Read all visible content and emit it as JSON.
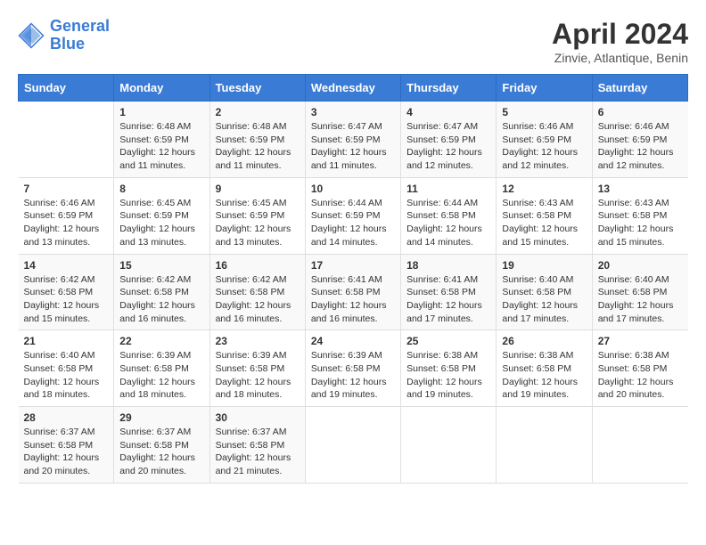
{
  "logo": {
    "line1": "General",
    "line2": "Blue"
  },
  "title": "April 2024",
  "subtitle": "Zinvie, Atlantique, Benin",
  "days_header": [
    "Sunday",
    "Monday",
    "Tuesday",
    "Wednesday",
    "Thursday",
    "Friday",
    "Saturday"
  ],
  "weeks": [
    [
      {
        "day": "",
        "sunrise": "",
        "sunset": "",
        "daylight": ""
      },
      {
        "day": "1",
        "sunrise": "Sunrise: 6:48 AM",
        "sunset": "Sunset: 6:59 PM",
        "daylight": "Daylight: 12 hours and 11 minutes."
      },
      {
        "day": "2",
        "sunrise": "Sunrise: 6:48 AM",
        "sunset": "Sunset: 6:59 PM",
        "daylight": "Daylight: 12 hours and 11 minutes."
      },
      {
        "day": "3",
        "sunrise": "Sunrise: 6:47 AM",
        "sunset": "Sunset: 6:59 PM",
        "daylight": "Daylight: 12 hours and 11 minutes."
      },
      {
        "day": "4",
        "sunrise": "Sunrise: 6:47 AM",
        "sunset": "Sunset: 6:59 PM",
        "daylight": "Daylight: 12 hours and 12 minutes."
      },
      {
        "day": "5",
        "sunrise": "Sunrise: 6:46 AM",
        "sunset": "Sunset: 6:59 PM",
        "daylight": "Daylight: 12 hours and 12 minutes."
      },
      {
        "day": "6",
        "sunrise": "Sunrise: 6:46 AM",
        "sunset": "Sunset: 6:59 PM",
        "daylight": "Daylight: 12 hours and 12 minutes."
      }
    ],
    [
      {
        "day": "7",
        "sunrise": "Sunrise: 6:46 AM",
        "sunset": "Sunset: 6:59 PM",
        "daylight": "Daylight: 12 hours and 13 minutes."
      },
      {
        "day": "8",
        "sunrise": "Sunrise: 6:45 AM",
        "sunset": "Sunset: 6:59 PM",
        "daylight": "Daylight: 12 hours and 13 minutes."
      },
      {
        "day": "9",
        "sunrise": "Sunrise: 6:45 AM",
        "sunset": "Sunset: 6:59 PM",
        "daylight": "Daylight: 12 hours and 13 minutes."
      },
      {
        "day": "10",
        "sunrise": "Sunrise: 6:44 AM",
        "sunset": "Sunset: 6:59 PM",
        "daylight": "Daylight: 12 hours and 14 minutes."
      },
      {
        "day": "11",
        "sunrise": "Sunrise: 6:44 AM",
        "sunset": "Sunset: 6:58 PM",
        "daylight": "Daylight: 12 hours and 14 minutes."
      },
      {
        "day": "12",
        "sunrise": "Sunrise: 6:43 AM",
        "sunset": "Sunset: 6:58 PM",
        "daylight": "Daylight: 12 hours and 15 minutes."
      },
      {
        "day": "13",
        "sunrise": "Sunrise: 6:43 AM",
        "sunset": "Sunset: 6:58 PM",
        "daylight": "Daylight: 12 hours and 15 minutes."
      }
    ],
    [
      {
        "day": "14",
        "sunrise": "Sunrise: 6:42 AM",
        "sunset": "Sunset: 6:58 PM",
        "daylight": "Daylight: 12 hours and 15 minutes."
      },
      {
        "day": "15",
        "sunrise": "Sunrise: 6:42 AM",
        "sunset": "Sunset: 6:58 PM",
        "daylight": "Daylight: 12 hours and 16 minutes."
      },
      {
        "day": "16",
        "sunrise": "Sunrise: 6:42 AM",
        "sunset": "Sunset: 6:58 PM",
        "daylight": "Daylight: 12 hours and 16 minutes."
      },
      {
        "day": "17",
        "sunrise": "Sunrise: 6:41 AM",
        "sunset": "Sunset: 6:58 PM",
        "daylight": "Daylight: 12 hours and 16 minutes."
      },
      {
        "day": "18",
        "sunrise": "Sunrise: 6:41 AM",
        "sunset": "Sunset: 6:58 PM",
        "daylight": "Daylight: 12 hours and 17 minutes."
      },
      {
        "day": "19",
        "sunrise": "Sunrise: 6:40 AM",
        "sunset": "Sunset: 6:58 PM",
        "daylight": "Daylight: 12 hours and 17 minutes."
      },
      {
        "day": "20",
        "sunrise": "Sunrise: 6:40 AM",
        "sunset": "Sunset: 6:58 PM",
        "daylight": "Daylight: 12 hours and 17 minutes."
      }
    ],
    [
      {
        "day": "21",
        "sunrise": "Sunrise: 6:40 AM",
        "sunset": "Sunset: 6:58 PM",
        "daylight": "Daylight: 12 hours and 18 minutes."
      },
      {
        "day": "22",
        "sunrise": "Sunrise: 6:39 AM",
        "sunset": "Sunset: 6:58 PM",
        "daylight": "Daylight: 12 hours and 18 minutes."
      },
      {
        "day": "23",
        "sunrise": "Sunrise: 6:39 AM",
        "sunset": "Sunset: 6:58 PM",
        "daylight": "Daylight: 12 hours and 18 minutes."
      },
      {
        "day": "24",
        "sunrise": "Sunrise: 6:39 AM",
        "sunset": "Sunset: 6:58 PM",
        "daylight": "Daylight: 12 hours and 19 minutes."
      },
      {
        "day": "25",
        "sunrise": "Sunrise: 6:38 AM",
        "sunset": "Sunset: 6:58 PM",
        "daylight": "Daylight: 12 hours and 19 minutes."
      },
      {
        "day": "26",
        "sunrise": "Sunrise: 6:38 AM",
        "sunset": "Sunset: 6:58 PM",
        "daylight": "Daylight: 12 hours and 19 minutes."
      },
      {
        "day": "27",
        "sunrise": "Sunrise: 6:38 AM",
        "sunset": "Sunset: 6:58 PM",
        "daylight": "Daylight: 12 hours and 20 minutes."
      }
    ],
    [
      {
        "day": "28",
        "sunrise": "Sunrise: 6:37 AM",
        "sunset": "Sunset: 6:58 PM",
        "daylight": "Daylight: 12 hours and 20 minutes."
      },
      {
        "day": "29",
        "sunrise": "Sunrise: 6:37 AM",
        "sunset": "Sunset: 6:58 PM",
        "daylight": "Daylight: 12 hours and 20 minutes."
      },
      {
        "day": "30",
        "sunrise": "Sunrise: 6:37 AM",
        "sunset": "Sunset: 6:58 PM",
        "daylight": "Daylight: 12 hours and 21 minutes."
      },
      {
        "day": "",
        "sunrise": "",
        "sunset": "",
        "daylight": ""
      },
      {
        "day": "",
        "sunrise": "",
        "sunset": "",
        "daylight": ""
      },
      {
        "day": "",
        "sunrise": "",
        "sunset": "",
        "daylight": ""
      },
      {
        "day": "",
        "sunrise": "",
        "sunset": "",
        "daylight": ""
      }
    ]
  ]
}
